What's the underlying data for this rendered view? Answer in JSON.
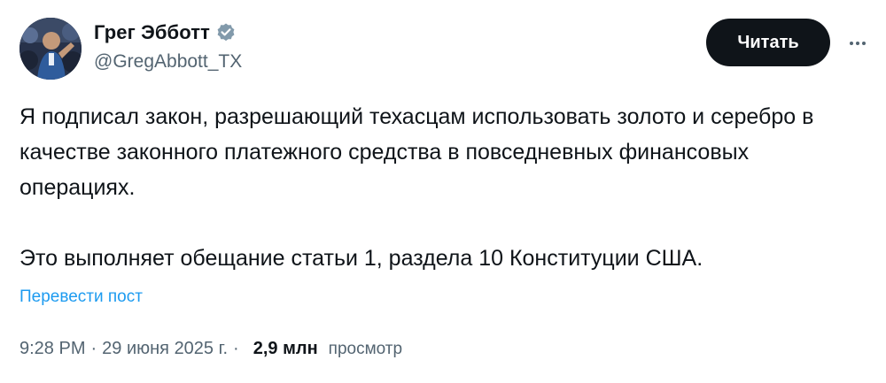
{
  "author": {
    "display_name": "Грег Эбботт",
    "handle": "@GregAbbott_TX",
    "verified_icon": "verified-badge-icon",
    "badge_color": "#829aab"
  },
  "actions": {
    "follow_label": "Читать",
    "more_icon": "more-dots-icon"
  },
  "tweet": {
    "paragraph_1": "Я подписал закон, разрешающий техасцам использовать золото и серебро в качестве законного платежного средства в повседневных финансовых операциях.",
    "paragraph_2": "Это выполняет обещание статьи 1, раздела 10 Конституции США.",
    "translate_label": "Перевести пост"
  },
  "meta": {
    "time": "9:28 PM",
    "separator": "·",
    "date": "29 июня 2025 г.",
    "views_count": "2,9 млн",
    "views_label": "просмотр"
  },
  "colors": {
    "text_primary": "#0f1419",
    "text_secondary": "#536471",
    "link": "#1d9bf0",
    "button_bg": "#0f1419"
  }
}
